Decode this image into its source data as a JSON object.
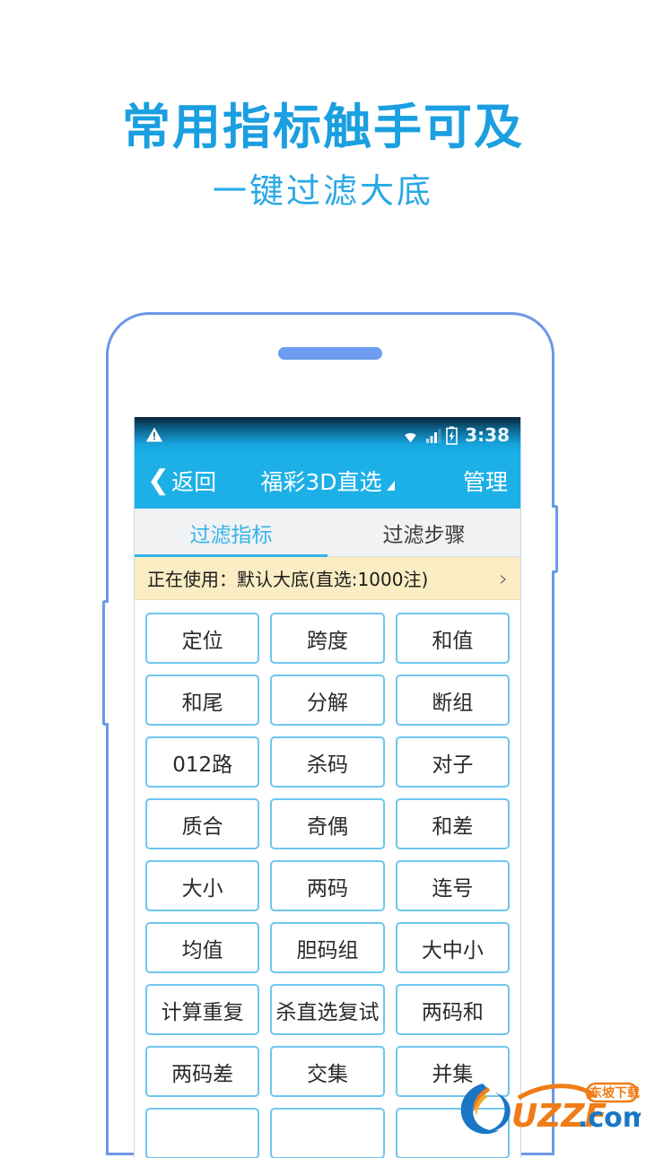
{
  "promo": {
    "title": "常用指标触手可及",
    "subtitle": "一键过滤大底"
  },
  "colors": {
    "accent_blue": "#1cb0e6",
    "promo_blue": "#1a9fe0",
    "frame_blue": "#6c97e8",
    "cell_border": "#6ec6ee",
    "banner_bg": "#faecc3"
  },
  "statusbar": {
    "warning_icon": "warning-triangle-icon",
    "wifi_icon": "wifi-icon",
    "signal_icon": "signal-bars-icon",
    "battery_icon": "battery-charging-icon",
    "time": "3:38"
  },
  "navbar": {
    "back_label": "返回",
    "back_icon": "chevron-left-icon",
    "title": "福彩3D直选",
    "title_dropdown_icon": "triangle-down-icon",
    "right_label": "管理"
  },
  "tabs": [
    {
      "label": "过滤指标",
      "active": true
    },
    {
      "label": "过滤步骤",
      "active": false
    }
  ],
  "banner": {
    "text": "正在使用：默认大底(直选:1000注)",
    "chevron": "›"
  },
  "grid": {
    "items": [
      "定位",
      "跨度",
      "和值",
      "和尾",
      "分解",
      "断组",
      "012路",
      "杀码",
      "对子",
      "质合",
      "奇偶",
      "和差",
      "大小",
      "两码",
      "连号",
      "均值",
      "胆码组",
      "大中小",
      "计算重复",
      "杀直选复试",
      "两码和",
      "两码差",
      "交集",
      "并集",
      "",
      "",
      ""
    ]
  },
  "watermark": {
    "brand": "UZZF",
    "tld": ".com",
    "badge": "东坡下载"
  }
}
